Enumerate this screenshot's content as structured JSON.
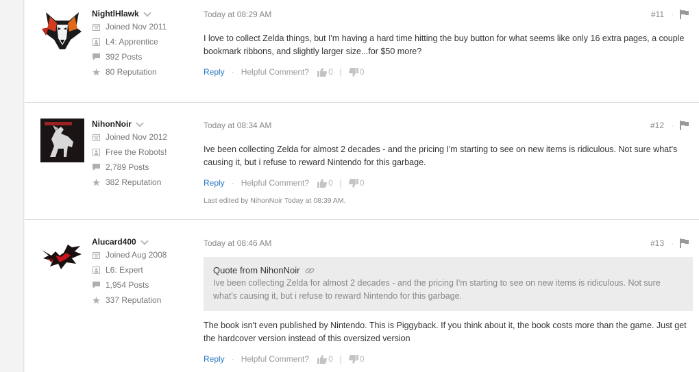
{
  "colors": {
    "link": "#2b78c4",
    "muted": "#888888",
    "border": "#dcdcdc"
  },
  "posts": [
    {
      "username": "NightlHlawk",
      "avatar": "wolf-avatar",
      "joined": "Joined Nov 2011",
      "rank": "L4: Apprentice",
      "posts": "392 Posts",
      "reputation": "80 Reputation",
      "time": "Today at 08:29 AM",
      "number": "#11",
      "body": "I love to collect Zelda things, but I'm having a hard time hitting the buy button for what seems like only 16 extra pages, a couple bookmark ribbons, and slightly larger size...for $50 more?",
      "reply": "Reply",
      "helpful": "Helpful Comment?",
      "up": "0",
      "down": "0"
    },
    {
      "username": "NihonNoir",
      "avatar": "horse-avatar",
      "joined": "Joined Nov 2012",
      "rank": "Free the Robots!",
      "posts": "2,789 Posts",
      "reputation": "382 Reputation",
      "time": "Today at 08:34 AM",
      "number": "#12",
      "body": "Ive been collecting Zelda for almost 2 decades - and the pricing I'm starting to see on new items is ridiculous. Not sure what's causing it, but i refuse to reward Nintendo for this garbage.",
      "reply": "Reply",
      "helpful": "Helpful Comment?",
      "up": "0",
      "down": "0",
      "edited": "Last edited by NihonNoir Today at 08:39 AM."
    },
    {
      "username": "Alucard400",
      "avatar": "bat-avatar",
      "joined": "Joined Aug 2008",
      "rank": "L6: Expert",
      "posts": "1,954 Posts",
      "reputation": "337 Reputation",
      "time": "Today at 08:46 AM",
      "number": "#13",
      "quote_head": "Quote from NihonNoir",
      "quote_text": "Ive been collecting Zelda for almost 2 decades - and the pricing I'm starting to see on new items is ridiculous. Not sure what's causing it, but i refuse to reward Nintendo for this garbage.",
      "body": "The book isn't even published by Nintendo. This is Piggyback. If you think about it, the book costs more than the game. Just get the hardcover version instead of this oversized version",
      "reply": "Reply",
      "helpful": "Helpful Comment?",
      "up": "0",
      "down": "0"
    }
  ],
  "separators": {
    "dot": "·",
    "bar": "|"
  }
}
